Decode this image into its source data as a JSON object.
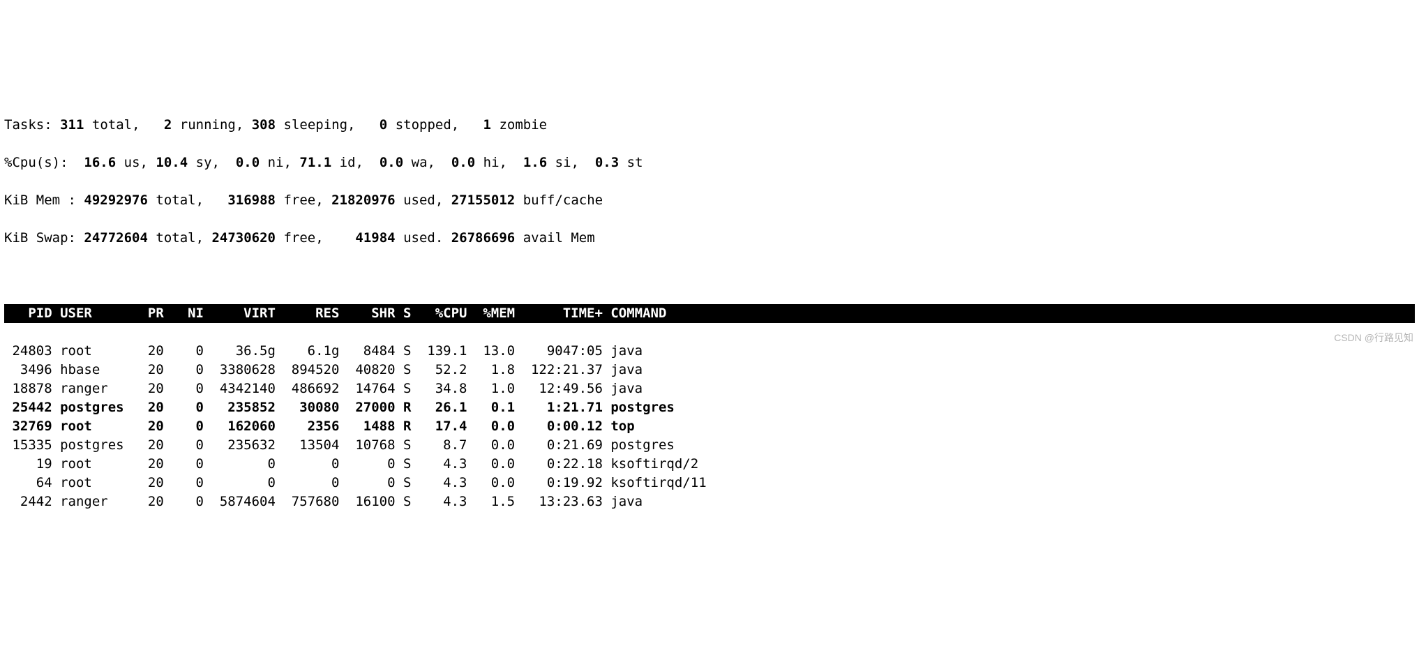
{
  "tasks": {
    "label": "Tasks:",
    "total": "311",
    "total_lbl": "total,",
    "running": "2",
    "running_lbl": "running,",
    "sleeping": "308",
    "sleeping_lbl": "sleeping,",
    "stopped": "0",
    "stopped_lbl": "stopped,",
    "zombie": "1",
    "zombie_lbl": "zombie"
  },
  "cpu": {
    "label": "%Cpu(s):",
    "us": "16.6",
    "us_lbl": "us,",
    "sy": "10.4",
    "sy_lbl": "sy,",
    "ni": "0.0",
    "ni_lbl": "ni,",
    "id": "71.1",
    "id_lbl": "id,",
    "wa": "0.0",
    "wa_lbl": "wa,",
    "hi": "0.0",
    "hi_lbl": "hi,",
    "si": "1.6",
    "si_lbl": "si,",
    "st": "0.3",
    "st_lbl": "st"
  },
  "mem": {
    "label": "KiB Mem :",
    "total": "49292976",
    "total_lbl": "total,",
    "free": "316988",
    "free_lbl": "free,",
    "used": "21820976",
    "used_lbl": "used,",
    "buff": "27155012",
    "buff_lbl": "buff/cache"
  },
  "swap": {
    "label": "KiB Swap:",
    "total": "24772604",
    "total_lbl": "total,",
    "free": "24730620",
    "free_lbl": "free,",
    "used": "41984",
    "used_lbl": "used.",
    "avail": "26786696",
    "avail_lbl": "avail Mem"
  },
  "columns": {
    "pid": "PID",
    "user": "USER",
    "pr": "PR",
    "ni": "NI",
    "virt": "VIRT",
    "res": "RES",
    "shr": "SHR",
    "s": "S",
    "cpu": "%CPU",
    "mem": "%MEM",
    "time": "TIME+",
    "cmd": "COMMAND"
  },
  "processes": [
    {
      "pid": "24803",
      "user": "root",
      "pr": "20",
      "ni": "0",
      "virt": "36.5g",
      "res": "6.1g",
      "shr": "8484",
      "s": "S",
      "cpu": "139.1",
      "mem": "13.0",
      "time": "9047:05",
      "cmd": "java",
      "bold": false
    },
    {
      "pid": "3496",
      "user": "hbase",
      "pr": "20",
      "ni": "0",
      "virt": "3380628",
      "res": "894520",
      "shr": "40820",
      "s": "S",
      "cpu": "52.2",
      "mem": "1.8",
      "time": "122:21.37",
      "cmd": "java",
      "bold": false
    },
    {
      "pid": "18878",
      "user": "ranger",
      "pr": "20",
      "ni": "0",
      "virt": "4342140",
      "res": "486692",
      "shr": "14764",
      "s": "S",
      "cpu": "34.8",
      "mem": "1.0",
      "time": "12:49.56",
      "cmd": "java",
      "bold": false
    },
    {
      "pid": "25442",
      "user": "postgres",
      "pr": "20",
      "ni": "0",
      "virt": "235852",
      "res": "30080",
      "shr": "27000",
      "s": "R",
      "cpu": "26.1",
      "mem": "0.1",
      "time": "1:21.71",
      "cmd": "postgres",
      "bold": true
    },
    {
      "pid": "32769",
      "user": "root",
      "pr": "20",
      "ni": "0",
      "virt": "162060",
      "res": "2356",
      "shr": "1488",
      "s": "R",
      "cpu": "17.4",
      "mem": "0.0",
      "time": "0:00.12",
      "cmd": "top",
      "bold": true
    },
    {
      "pid": "15335",
      "user": "postgres",
      "pr": "20",
      "ni": "0",
      "virt": "235632",
      "res": "13504",
      "shr": "10768",
      "s": "S",
      "cpu": "8.7",
      "mem": "0.0",
      "time": "0:21.69",
      "cmd": "postgres",
      "bold": false
    },
    {
      "pid": "19",
      "user": "root",
      "pr": "20",
      "ni": "0",
      "virt": "0",
      "res": "0",
      "shr": "0",
      "s": "S",
      "cpu": "4.3",
      "mem": "0.0",
      "time": "0:22.18",
      "cmd": "ksoftirqd/2",
      "bold": false
    },
    {
      "pid": "64",
      "user": "root",
      "pr": "20",
      "ni": "0",
      "virt": "0",
      "res": "0",
      "shr": "0",
      "s": "S",
      "cpu": "4.3",
      "mem": "0.0",
      "time": "0:19.92",
      "cmd": "ksoftirqd/11",
      "bold": false
    },
    {
      "pid": "2442",
      "user": "ranger",
      "pr": "20",
      "ni": "0",
      "virt": "5874604",
      "res": "757680",
      "shr": "16100",
      "s": "S",
      "cpu": "4.3",
      "mem": "1.5",
      "time": "13:23.63",
      "cmd": "java",
      "bold": false
    }
  ],
  "watermark": "CSDN @行路见知"
}
